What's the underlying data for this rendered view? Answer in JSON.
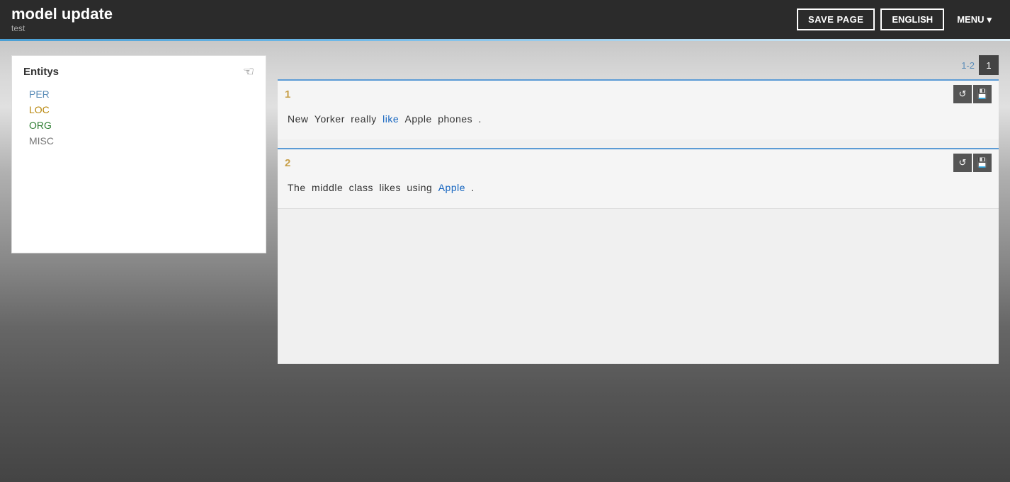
{
  "header": {
    "title": "model update",
    "subtitle": "test",
    "save_label": "SAVE PAGE",
    "language_label": "ENGLISH",
    "menu_label": "MENU"
  },
  "entities": {
    "title": "Entitys",
    "items": [
      {
        "label": "PER",
        "color_class": "entity-per"
      },
      {
        "label": "LOC",
        "color_class": "entity-loc"
      },
      {
        "label": "ORG",
        "color_class": "entity-org"
      },
      {
        "label": "MISC",
        "color_class": "entity-misc"
      }
    ]
  },
  "pagination": {
    "range": "1-2",
    "current": "1"
  },
  "sentences": [
    {
      "number": "1",
      "words": [
        {
          "text": "New",
          "highlight": false
        },
        {
          "text": "Yorker",
          "highlight": false
        },
        {
          "text": "really",
          "highlight": false
        },
        {
          "text": "like",
          "highlight": true
        },
        {
          "text": "Apple",
          "highlight": false
        },
        {
          "text": "phones",
          "highlight": false
        },
        {
          "text": ".",
          "highlight": false
        }
      ]
    },
    {
      "number": "2",
      "words": [
        {
          "text": "The",
          "highlight": false
        },
        {
          "text": "middle",
          "highlight": false
        },
        {
          "text": "class",
          "highlight": false
        },
        {
          "text": "likes",
          "highlight": false
        },
        {
          "text": "using",
          "highlight": false
        },
        {
          "text": "Apple",
          "highlight": true
        },
        {
          "text": ".",
          "highlight": false
        }
      ]
    }
  ],
  "icons": {
    "hand_pointer": "☜",
    "refresh": "↺",
    "save_small": "💾",
    "chevron_down": "▾"
  }
}
